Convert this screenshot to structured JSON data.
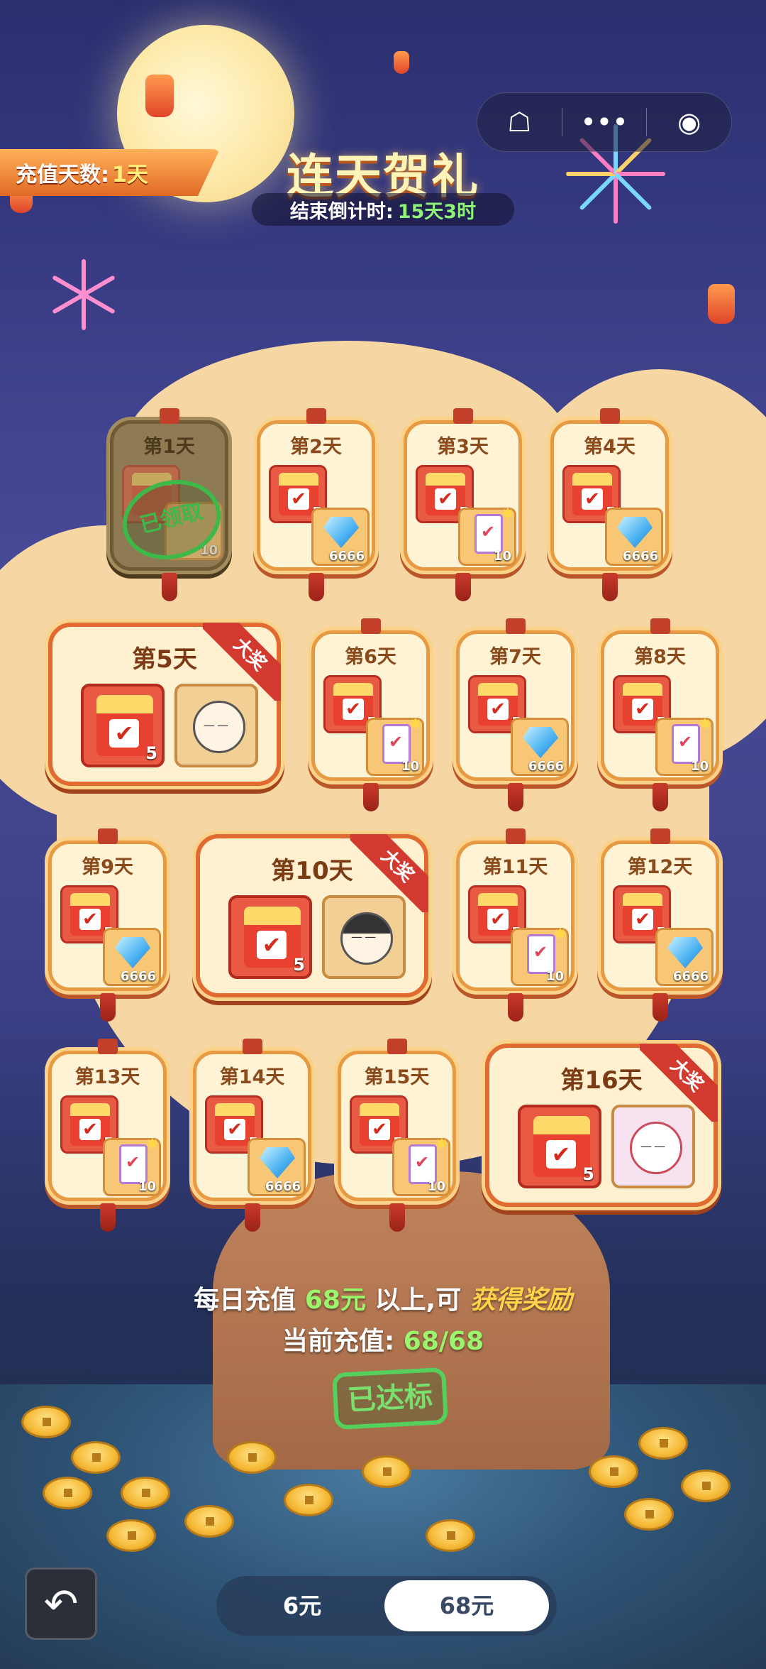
{
  "header": {
    "recharge_days_label": "充值天数:",
    "recharge_days_value": "1天",
    "title": "连天贺礼",
    "countdown_label": "结束倒计时:",
    "countdown_value": "15天3时"
  },
  "capsule": {
    "ghost_icon": "ghost-icon",
    "more_icon": "more-dots-icon",
    "target_icon": "record-icon"
  },
  "days": {
    "d1": {
      "label": "第1天",
      "qty": "10",
      "stamp": "已领取"
    },
    "d2": {
      "label": "第2天",
      "gift_qty": "5",
      "item_qty": "6666"
    },
    "d3": {
      "label": "第3天",
      "gift_qty": "5",
      "item_qty": "10"
    },
    "d4": {
      "label": "第4天",
      "gift_qty": "5",
      "item_qty": "6666"
    },
    "d5": {
      "label": "第5天",
      "gift_qty": "5",
      "ribbon": "大奖"
    },
    "d6": {
      "label": "第6天",
      "gift_qty": "5",
      "item_qty": "10"
    },
    "d7": {
      "label": "第7天",
      "gift_qty": "5",
      "item_qty": "6666"
    },
    "d8": {
      "label": "第8天",
      "gift_qty": "5",
      "item_qty": "10"
    },
    "d9": {
      "label": "第9天",
      "gift_qty": "5",
      "item_qty": "6666"
    },
    "d10": {
      "label": "第10天",
      "gift_qty": "5",
      "ribbon": "大奖"
    },
    "d11": {
      "label": "第11天",
      "gift_qty": "5",
      "item_qty": "10"
    },
    "d12": {
      "label": "第12天",
      "gift_qty": "5",
      "item_qty": "6666"
    },
    "d13": {
      "label": "第13天",
      "gift_qty": "5",
      "item_qty": "10"
    },
    "d14": {
      "label": "第14天",
      "gift_qty": "5",
      "item_qty": "6666"
    },
    "d15": {
      "label": "第15天",
      "gift_qty": "5",
      "item_qty": "10"
    },
    "d16": {
      "label": "第16天",
      "gift_qty": "5",
      "ribbon": "大奖"
    }
  },
  "info": {
    "line1_a": "每日充值",
    "line1_amount": "68元",
    "line1_b": "以上,可",
    "line1_c": "获得奖励",
    "line2_label": "当前充值:",
    "line2_value": "68/68",
    "status": "已达标"
  },
  "tabs": {
    "tab1": "6元",
    "tab2": "68元"
  },
  "colors": {
    "accent": "#e06a30",
    "success": "#55d05d"
  }
}
